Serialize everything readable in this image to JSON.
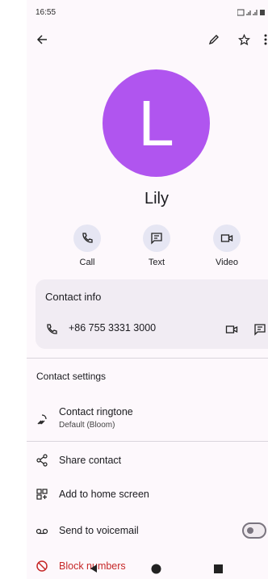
{
  "status": {
    "time": "16:55"
  },
  "contact": {
    "initial": "L",
    "name": "Lily",
    "avatar_color": "#b055ef"
  },
  "actions": [
    {
      "label": "Call",
      "icon": "phone-icon"
    },
    {
      "label": "Text",
      "icon": "message-icon"
    },
    {
      "label": "Video",
      "icon": "video-icon"
    }
  ],
  "contact_info": {
    "title": "Contact info",
    "phone": "+86 755 3331 3000"
  },
  "settings": {
    "title": "Contact settings",
    "ringtone_label": "Contact ringtone",
    "ringtone_value": "Default (Bloom)"
  },
  "menu": {
    "share": "Share contact",
    "home_screen": "Add to home screen",
    "voicemail": "Send to voicemail",
    "block": "Block numbers"
  },
  "colors": {
    "accent": "#b055ef",
    "danger": "#c62828",
    "pill": "#e6e6f3"
  }
}
